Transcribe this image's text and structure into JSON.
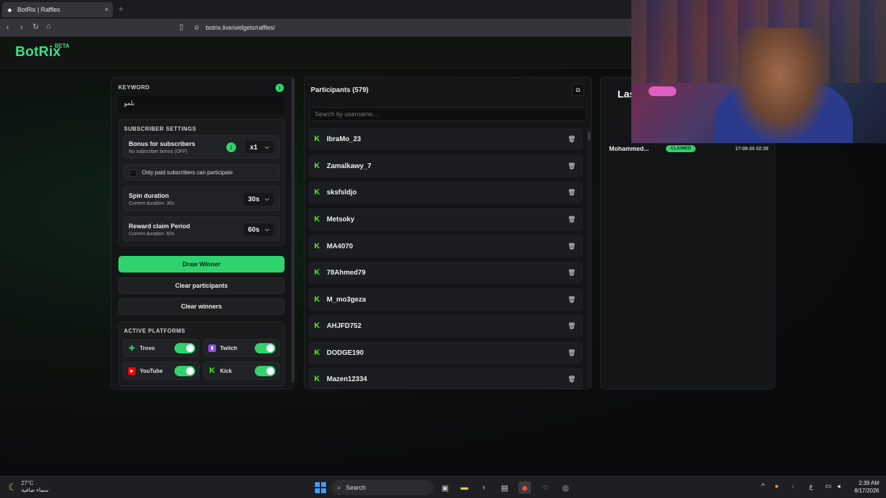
{
  "browser": {
    "tab_title": "BotRix | Raffles",
    "tab_close": "×",
    "new_tab": "+",
    "url": "botrix.live/widgets/raffles/"
  },
  "header": {
    "logo": "BotRix",
    "beta": "BETA"
  },
  "settings": {
    "keyword_label": "KEYWORD",
    "keyword_value": "بلمو",
    "subscriber_settings_title": "SUBSCRIBER SETTINGS",
    "bonus_title": "Bonus for subscribers",
    "bonus_sub": "No subscriber bonus (OFF)",
    "bonus_value": "x1",
    "paid_only_label": "Only paid subscribers can participate",
    "spin_title": "Spin duration",
    "spin_sub": "Current duration: 30s",
    "spin_value": "30s",
    "claim_title": "Reward claim Period",
    "claim_sub": "Current duration: 60s",
    "claim_value": "60s",
    "draw_button": "Draw Winner",
    "clear_participants_button": "Clear participants",
    "clear_winners_button": "Clear winners",
    "platforms_title": "ACTIVE PLATFORMS",
    "platforms": [
      {
        "name": "Trovo",
        "enabled": true,
        "color": "#19d66b"
      },
      {
        "name": "Twitch",
        "enabled": true,
        "color": "#9146ff"
      },
      {
        "name": "YouTube",
        "enabled": true,
        "color": "#ff0000"
      },
      {
        "name": "Kick",
        "enabled": true,
        "color": "#53fc18"
      }
    ]
  },
  "participants": {
    "title": "Participants (579)",
    "search_placeholder": "Search by username...",
    "list": [
      "IbraMo_23",
      "Zamalkawy_7",
      "sksfsldjo",
      "Metsoky",
      "MA4070",
      "78Ahmed79",
      "M_mo3geza",
      "AHJFD752",
      "DODGE190",
      "Mazen12334"
    ]
  },
  "winners": {
    "title_partial": "Las",
    "rows": [
      {
        "name": "Mohammed...",
        "status": "CLAIMED",
        "date": "17-08-26 02:38"
      }
    ]
  },
  "taskbar": {
    "temp": "27°C",
    "weather_desc": "سماء صافية",
    "search_label": "Search",
    "lang": "ع",
    "time": "2:39 AM",
    "date": "8/17/2026"
  },
  "colors": {
    "accent": "#2fd36d",
    "kick": "#53fc18",
    "panel": "#141517"
  }
}
